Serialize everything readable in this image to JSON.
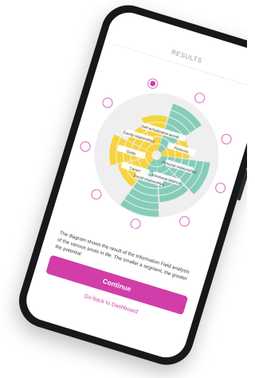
{
  "header": {
    "title": "RESULTS"
  },
  "chart_data": {
    "type": "radial-bar",
    "categories": [
      "Financial",
      "Finances",
      "Personal relationships",
      "Emotional balance",
      "Social relationships",
      "Career",
      "Goals",
      "Family relationships",
      "Self-actualization"
    ],
    "colors": {
      "yellow": "#f6d235",
      "teal": "#7fcab5",
      "light_gray": "#efefef",
      "selected_dot": "#c63fa6",
      "dot_outline": "#e07fc6"
    }
  },
  "content": {
    "description": "The diagram shows the result of the Information Field analysis of the various areas in life. The smaller a segment, the greater the potential"
  },
  "actions": {
    "continue_label": "Continue",
    "back_label": "Go back to Dashboard"
  }
}
